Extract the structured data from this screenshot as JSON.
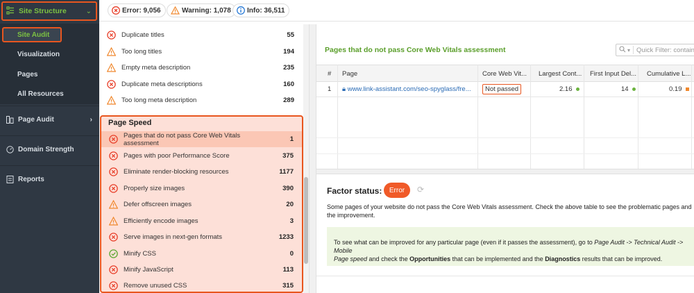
{
  "sidebar": {
    "active_section": "Site Structure",
    "sub_items": [
      "Site Audit",
      "Visualization",
      "Pages",
      "All Resources"
    ],
    "nav": [
      {
        "label": "Page Audit",
        "icon": "page-audit-icon"
      },
      {
        "label": "Domain Strength",
        "icon": "gauge-icon"
      },
      {
        "label": "Reports",
        "icon": "reports-icon"
      }
    ]
  },
  "summary": {
    "error": "Error: 9,056",
    "warning": "Warning: 1,078",
    "info": "Info: 36,511"
  },
  "factors_top": [
    {
      "status": "error",
      "label": "Duplicate titles",
      "count": "55"
    },
    {
      "status": "warning",
      "label": "Too long titles",
      "count": "194"
    },
    {
      "status": "warning",
      "label": "Empty meta description",
      "count": "235"
    },
    {
      "status": "error",
      "label": "Duplicate meta descriptions",
      "count": "160"
    },
    {
      "status": "warning",
      "label": "Too long meta description",
      "count": "289"
    }
  ],
  "page_speed": {
    "title": "Page Speed",
    "items": [
      {
        "status": "error",
        "label": "Pages that do not pass Core Web Vitals assessment",
        "count": "1"
      },
      {
        "status": "error",
        "label": "Pages with poor Performance Score",
        "count": "375"
      },
      {
        "status": "error",
        "label": "Eliminate render-blocking resources",
        "count": "1177"
      },
      {
        "status": "error",
        "label": "Properly size images",
        "count": "390"
      },
      {
        "status": "warning",
        "label": "Defer offscreen images",
        "count": "20"
      },
      {
        "status": "warning",
        "label": "Efficiently encode images",
        "count": "3"
      },
      {
        "status": "error",
        "label": "Serve images in next-gen formats",
        "count": "1233"
      },
      {
        "status": "ok",
        "label": "Minify CSS",
        "count": "0"
      },
      {
        "status": "error",
        "label": "Minify JavaScript",
        "count": "113"
      },
      {
        "status": "error",
        "label": "Remove unused CSS",
        "count": "315"
      }
    ]
  },
  "details": {
    "title": "Pages that do not pass Core Web Vitals assessment",
    "filter_placeholder": "Quick Filter: contain",
    "columns": [
      "#",
      "Page",
      "Core Web Vit...",
      "Largest Cont...",
      "First Input Del...",
      "Cumulative L..."
    ],
    "row": {
      "index": "1",
      "page": "www.link-assistant.com/seo-spyglass/fre...",
      "cwv": "Not passed",
      "lcp": "2.16",
      "fid": "14",
      "cls": "0.19"
    },
    "colors": {
      "good": "#6cb33f",
      "poor": "#f0882d",
      "error": "#f05a28"
    }
  },
  "factor_status": {
    "label": "Factor status:",
    "status": "Error",
    "description": "Some pages of your website do not pass the Core Web Vitals assessment. Check the above table to see the problematic pages and the improvement.",
    "tip_start": "To see what can be improved for any particular page (even if it passes the assessment), go to ",
    "tip_path": "Page Audit -> Technical Audit -> Mobile",
    "tip_path2": "Page speed",
    "tip_mid": " and check the ",
    "tip_opps": "Opportunities",
    "tip_mid2": " that can be implemented and the ",
    "tip_diag": "Diagnostics",
    "tip_end": " results that can be improved."
  }
}
